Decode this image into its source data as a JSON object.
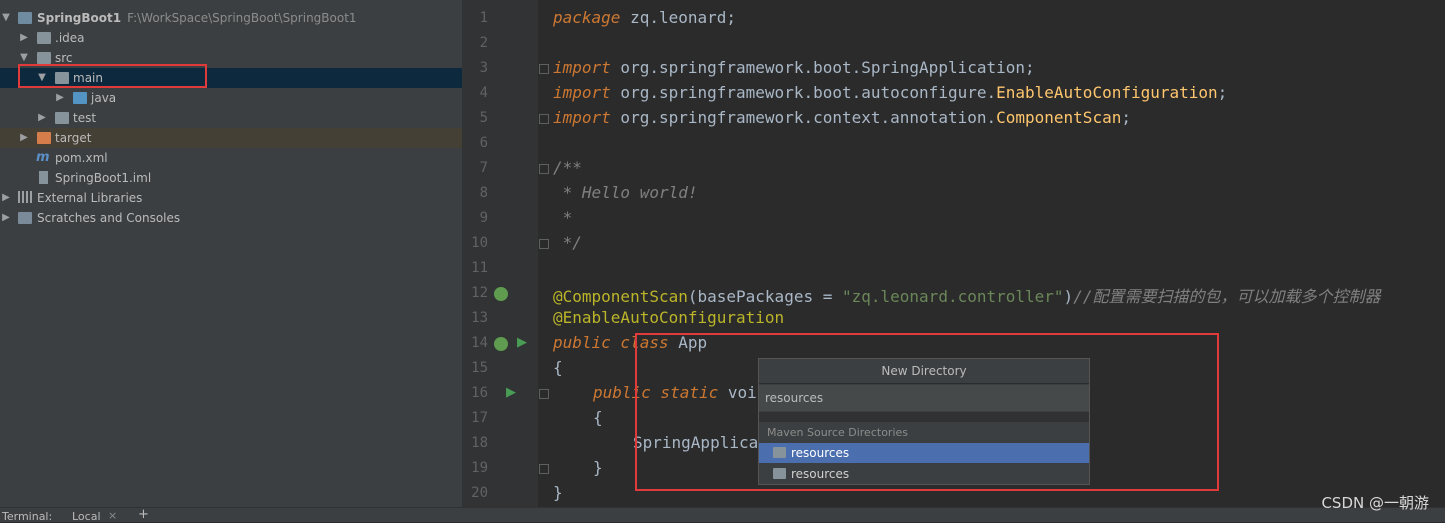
{
  "project_tree": {
    "items": [
      {
        "label": "SpringBoot1",
        "path": "F:\\WorkSpace\\SpringBoot\\SpringBoot1",
        "icon": "module-folder-icon",
        "expanded": true
      },
      {
        "label": ".idea",
        "icon": "folder-icon",
        "expanded": false
      },
      {
        "label": "src",
        "icon": "folder-icon",
        "expanded": true
      },
      {
        "label": "main",
        "icon": "folder-icon",
        "expanded": true
      },
      {
        "label": "java",
        "icon": "source-folder-icon",
        "expanded": false
      },
      {
        "label": "test",
        "icon": "folder-icon",
        "expanded": false
      },
      {
        "label": "target",
        "icon": "excluded-folder-icon",
        "expanded": false
      },
      {
        "label": "pom.xml",
        "icon": "maven-file-icon"
      },
      {
        "label": "SpringBoot1.iml",
        "icon": "iml-file-icon"
      },
      {
        "label": "External Libraries",
        "icon": "libraries-icon",
        "expanded": false
      },
      {
        "label": "Scratches and Consoles",
        "icon": "scratches-icon",
        "expanded": false
      }
    ]
  },
  "editor": {
    "line_numbers": [
      "1",
      "2",
      "3",
      "4",
      "5",
      "6",
      "7",
      "8",
      "9",
      "10",
      "11",
      "12",
      "13",
      "14",
      "15",
      "16",
      "17",
      "18",
      "19",
      "20"
    ],
    "code": {
      "l1_kw": "package",
      "l1_rest": " zq.leonard;",
      "l3_kw": "import",
      "l3_pkg": " org.springframework.boot.",
      "l3_cls": "SpringApplication",
      "l4_kw": "import",
      "l4_pkg": " org.springframework.boot.autoconfigure.",
      "l4_cls": "EnableAutoConfiguration",
      "l5_kw": "import",
      "l5_pkg": " org.springframework.context.annotation.",
      "l5_cls": "ComponentScan",
      "l7": "/**",
      "l8": " * Hello world!",
      "l9": " *",
      "l10": " */",
      "l12_ann": "@ComponentScan",
      "l12_a": "(basePackages = ",
      "l12_str": "\"zq.leonard.controller\"",
      "l12_b": ")",
      "l12_cm": "//配置需要扫描的包，可以加载多个控制器",
      "l13_ann": "@EnableAutoConfiguration",
      "l14_kw": "public class",
      "l14_rest": " App",
      "l15": "{",
      "l16_kw": "public static",
      "l16_rest": " voi",
      "l17": "{",
      "l18": "SpringApplica",
      "l19": "}",
      "l20": "}"
    }
  },
  "new_directory_popup": {
    "title": "New Directory",
    "input_value": "resources",
    "section_label": "Maven Source Directories",
    "items": [
      {
        "label": "resources",
        "selected": true
      },
      {
        "label": "resources",
        "selected": false
      }
    ]
  },
  "bottom_bar": {
    "terminal_label": "Terminal:",
    "local_tab_label": "Local",
    "close_symbol": "×",
    "add_symbol": "+"
  },
  "watermark": "CSDN @一朝游",
  "colors": {
    "highlight_border": "#e03a3a",
    "selection_row": "#0d293e",
    "popup_selected": "#4b6eaf"
  }
}
